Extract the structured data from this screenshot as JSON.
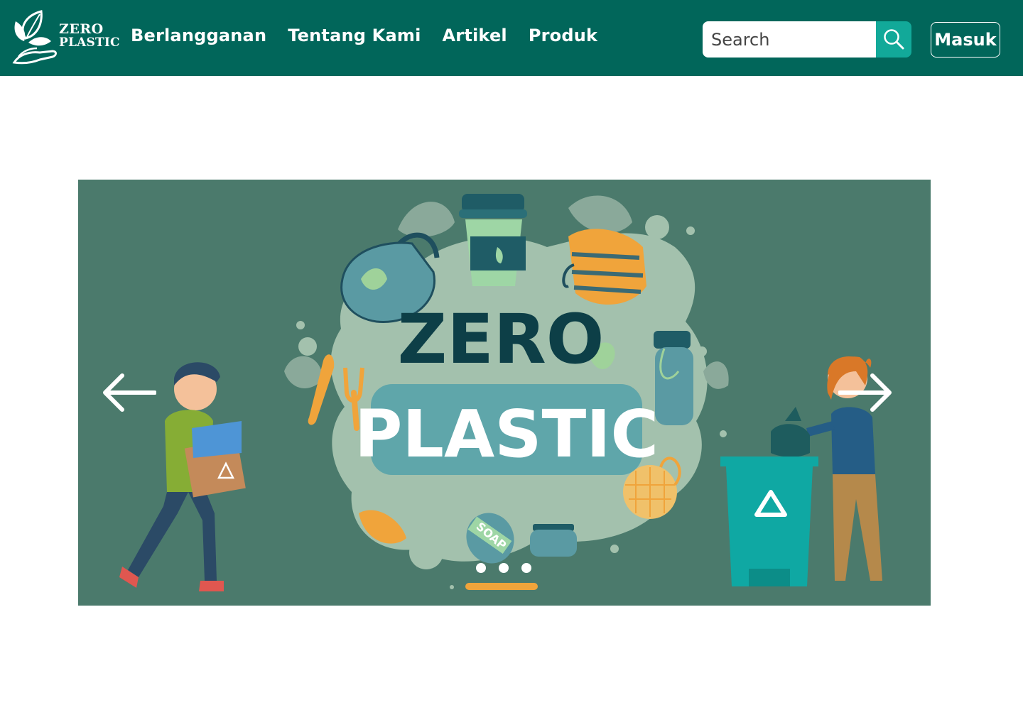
{
  "brand": {
    "line1": "ZERO",
    "line2": "PLASTIC"
  },
  "nav": {
    "links": [
      {
        "label": "Berlangganan"
      },
      {
        "label": "Tentang Kami"
      },
      {
        "label": "Artikel"
      },
      {
        "label": "Produk"
      }
    ]
  },
  "search": {
    "placeholder": "Search",
    "value": "",
    "icon": "search-icon"
  },
  "login": {
    "label": "Masuk"
  },
  "hero": {
    "title_line1": "ZERO",
    "title_line2": "PLASTIC",
    "soap_label": "SOAP",
    "active_slide": 1,
    "slide_count": 3
  },
  "colors": {
    "navbar": "#01665a",
    "accent": "#12a999",
    "banner_bg": "#4b7a6c"
  }
}
